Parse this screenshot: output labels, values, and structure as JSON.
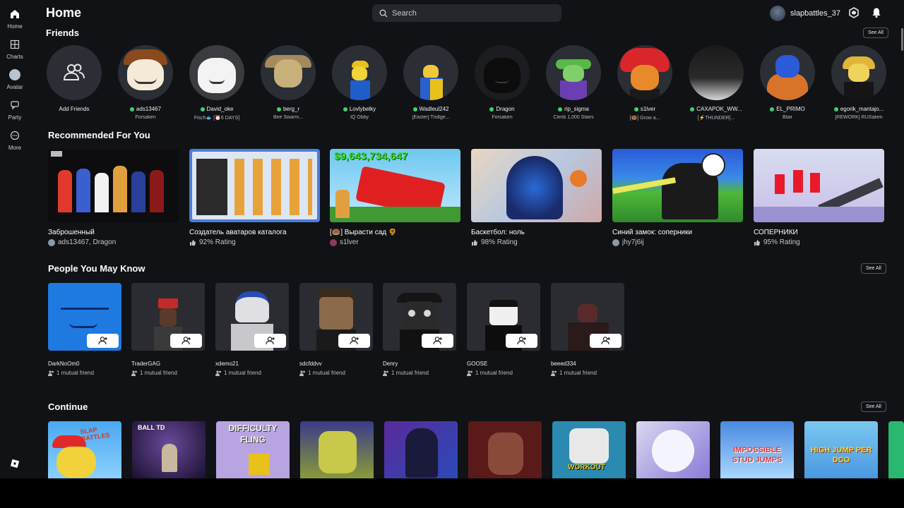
{
  "header": {
    "title": "Home",
    "search_placeholder": "Search",
    "username": "slapbattles_37"
  },
  "sidebar": [
    {
      "label": "Home",
      "icon": "home-icon"
    },
    {
      "label": "Charts",
      "icon": "charts-icon"
    },
    {
      "label": "Avatar",
      "icon": "avatar-icon"
    },
    {
      "label": "Party",
      "icon": "party-icon"
    },
    {
      "label": "More",
      "icon": "more-icon"
    }
  ],
  "friends": {
    "title": "Friends",
    "see_all": "See All",
    "add_label": "Add Friends",
    "items": [
      {
        "name": "ads13467",
        "game": "Forsaken"
      },
      {
        "name": "David_oke",
        "game": "Fisch🐟 [⏰6 DAYS]"
      },
      {
        "name": "berg_r",
        "game": "Bee Swarm..."
      },
      {
        "name": "Lovlybelky",
        "game": "IQ Obby"
      },
      {
        "name": "Wadleul242",
        "game": "[Easter] Trollge..."
      },
      {
        "name": "Dragon",
        "game": "Forsaken"
      },
      {
        "name": "rip_sigma",
        "game": "Climb 1,000 Stairs"
      },
      {
        "name": "s1lver",
        "game": "[🍩] Grow a..."
      },
      {
        "name": "CAXAPOK_WW...",
        "game": "[⚡THUNDER]..."
      },
      {
        "name": "EL_PRIMO",
        "game": "Blair"
      },
      {
        "name": "egorik_mantajo...",
        "game": "[REWORK] RUSaken"
      }
    ]
  },
  "recommended": {
    "title": "Recommended For You",
    "items": [
      {
        "title": "Заброшенный",
        "meta": "ads13467, Dragon"
      },
      {
        "title": "Создатель аватаров каталога",
        "meta": "92% Rating"
      },
      {
        "title": "[🍩] Вырасти сад 🌻",
        "meta": "s1lver",
        "banner": "$9,643,734,647"
      },
      {
        "title": "Баскетбол: ноль",
        "meta": "98% Rating"
      },
      {
        "title": "Синий замок: соперники",
        "meta": "jhy7j6ij"
      },
      {
        "title": "СОПЕРНИКИ",
        "meta": "95% Rating"
      }
    ]
  },
  "people": {
    "title": "People You May Know",
    "see_all": "See All",
    "items": [
      {
        "name": "DarkNoOm0",
        "mutual": "1 mutual friend"
      },
      {
        "name": "TraderGAG",
        "mutual": "1 mutual friend"
      },
      {
        "name": "xdemo21",
        "mutual": "1 mutual friend"
      },
      {
        "name": "sdcfddvv",
        "mutual": "1 mutual friend"
      },
      {
        "name": "Denry",
        "mutual": "1 mutual friend"
      },
      {
        "name": "GOOSE",
        "mutual": "1 mutual friend"
      },
      {
        "name": "beeed334",
        "mutual": "1 mutual friend"
      }
    ]
  },
  "continue": {
    "title": "Continue",
    "see_all": "See All",
    "thumb_text": [
      "SLAP BATTLES",
      "BALL TD",
      "DIFFICULTY FLING",
      "",
      "",
      "",
      "WORKOUT",
      "",
      "IMPOSSIBLE STUD JUMPS",
      "HIGH JUMP PER DCO"
    ]
  }
}
